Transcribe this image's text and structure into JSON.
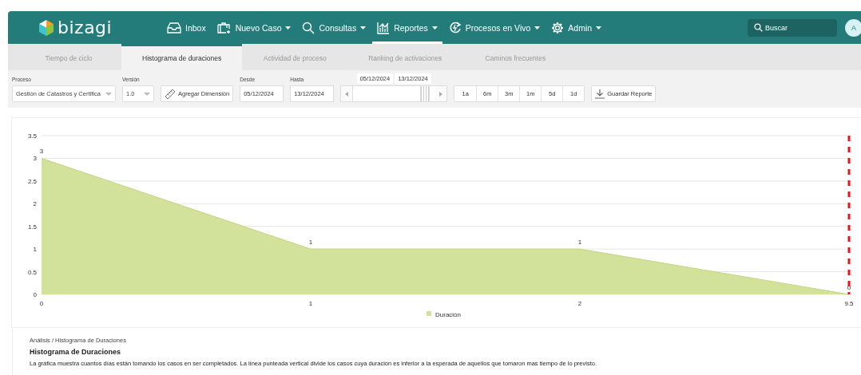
{
  "nav": {
    "logo": "bizagi",
    "items": [
      {
        "label": "Inbox",
        "dropdown": false,
        "selected": false
      },
      {
        "label": "Nuevo Caso",
        "dropdown": true,
        "selected": false
      },
      {
        "label": "Consultas",
        "dropdown": true,
        "selected": false
      },
      {
        "label": "Reportes",
        "dropdown": true,
        "selected": true
      },
      {
        "label": "Procesos en Vivo",
        "dropdown": true,
        "selected": false
      },
      {
        "label": "Admin",
        "dropdown": true,
        "selected": false
      }
    ],
    "search": {
      "placeholder": "Buscar"
    },
    "avatar": "A"
  },
  "tabs": [
    {
      "label": "Tiempo de ciclo",
      "selected": false
    },
    {
      "label": "Histograma de duraciones",
      "selected": true
    },
    {
      "label": "Actividad de proceso",
      "selected": false
    },
    {
      "label": "Ranking de activaciones",
      "selected": false
    },
    {
      "label": "Caminos frecuentes",
      "selected": false
    }
  ],
  "filters": {
    "proceso": {
      "label": "Proceso",
      "value": "Gestión de Catastros y Certifica"
    },
    "version": {
      "label": "Versión",
      "value": "1.0"
    },
    "add_dimension": "Agregar Dimensión",
    "desde": {
      "label": "Desde",
      "value": "05/12/2024"
    },
    "hasta": {
      "label": "Hasta",
      "value": "13/12/2024"
    },
    "range": {
      "start_label": "05/12/2024",
      "end_label": "13/12/2024",
      "level": 0.93
    },
    "periods": [
      {
        "label": "1a",
        "selected": false
      },
      {
        "label": "6m",
        "selected": false
      },
      {
        "label": "3m",
        "selected": false
      },
      {
        "label": "1m",
        "selected": false
      },
      {
        "label": "5d",
        "selected": false
      },
      {
        "label": "1d",
        "selected": false
      }
    ],
    "save": "Guardar Reporte"
  },
  "chart": {
    "chart_data": {
      "type": "area",
      "categories": [
        "0",
        "1",
        "2",
        "9.5"
      ],
      "series": [
        {
          "name": "Duración",
          "color": "#d3e29b",
          "values": [
            3,
            1,
            1,
            0
          ]
        }
      ],
      "ylim": [
        0,
        3.5
      ],
      "yticks": [
        0,
        0.5,
        1,
        1.5,
        2,
        2.5,
        3,
        3.5
      ],
      "data_labels": true,
      "grid": true,
      "ref_lines": [
        {
          "axis": "x",
          "value": "9.5",
          "color": "#e8141c"
        }
      ]
    }
  },
  "description": {
    "breadcrumb": "Análisis / Histograma de Duraciones",
    "title": "Histograma de Duraciones",
    "text": "La gráfica muestra cuantos días están tomando los casos en ser completados. La línea punteada vertical divide los casos cuya duración es inferior a la esperada de aquellos que tomaron mas tiempo de lo previsto."
  }
}
